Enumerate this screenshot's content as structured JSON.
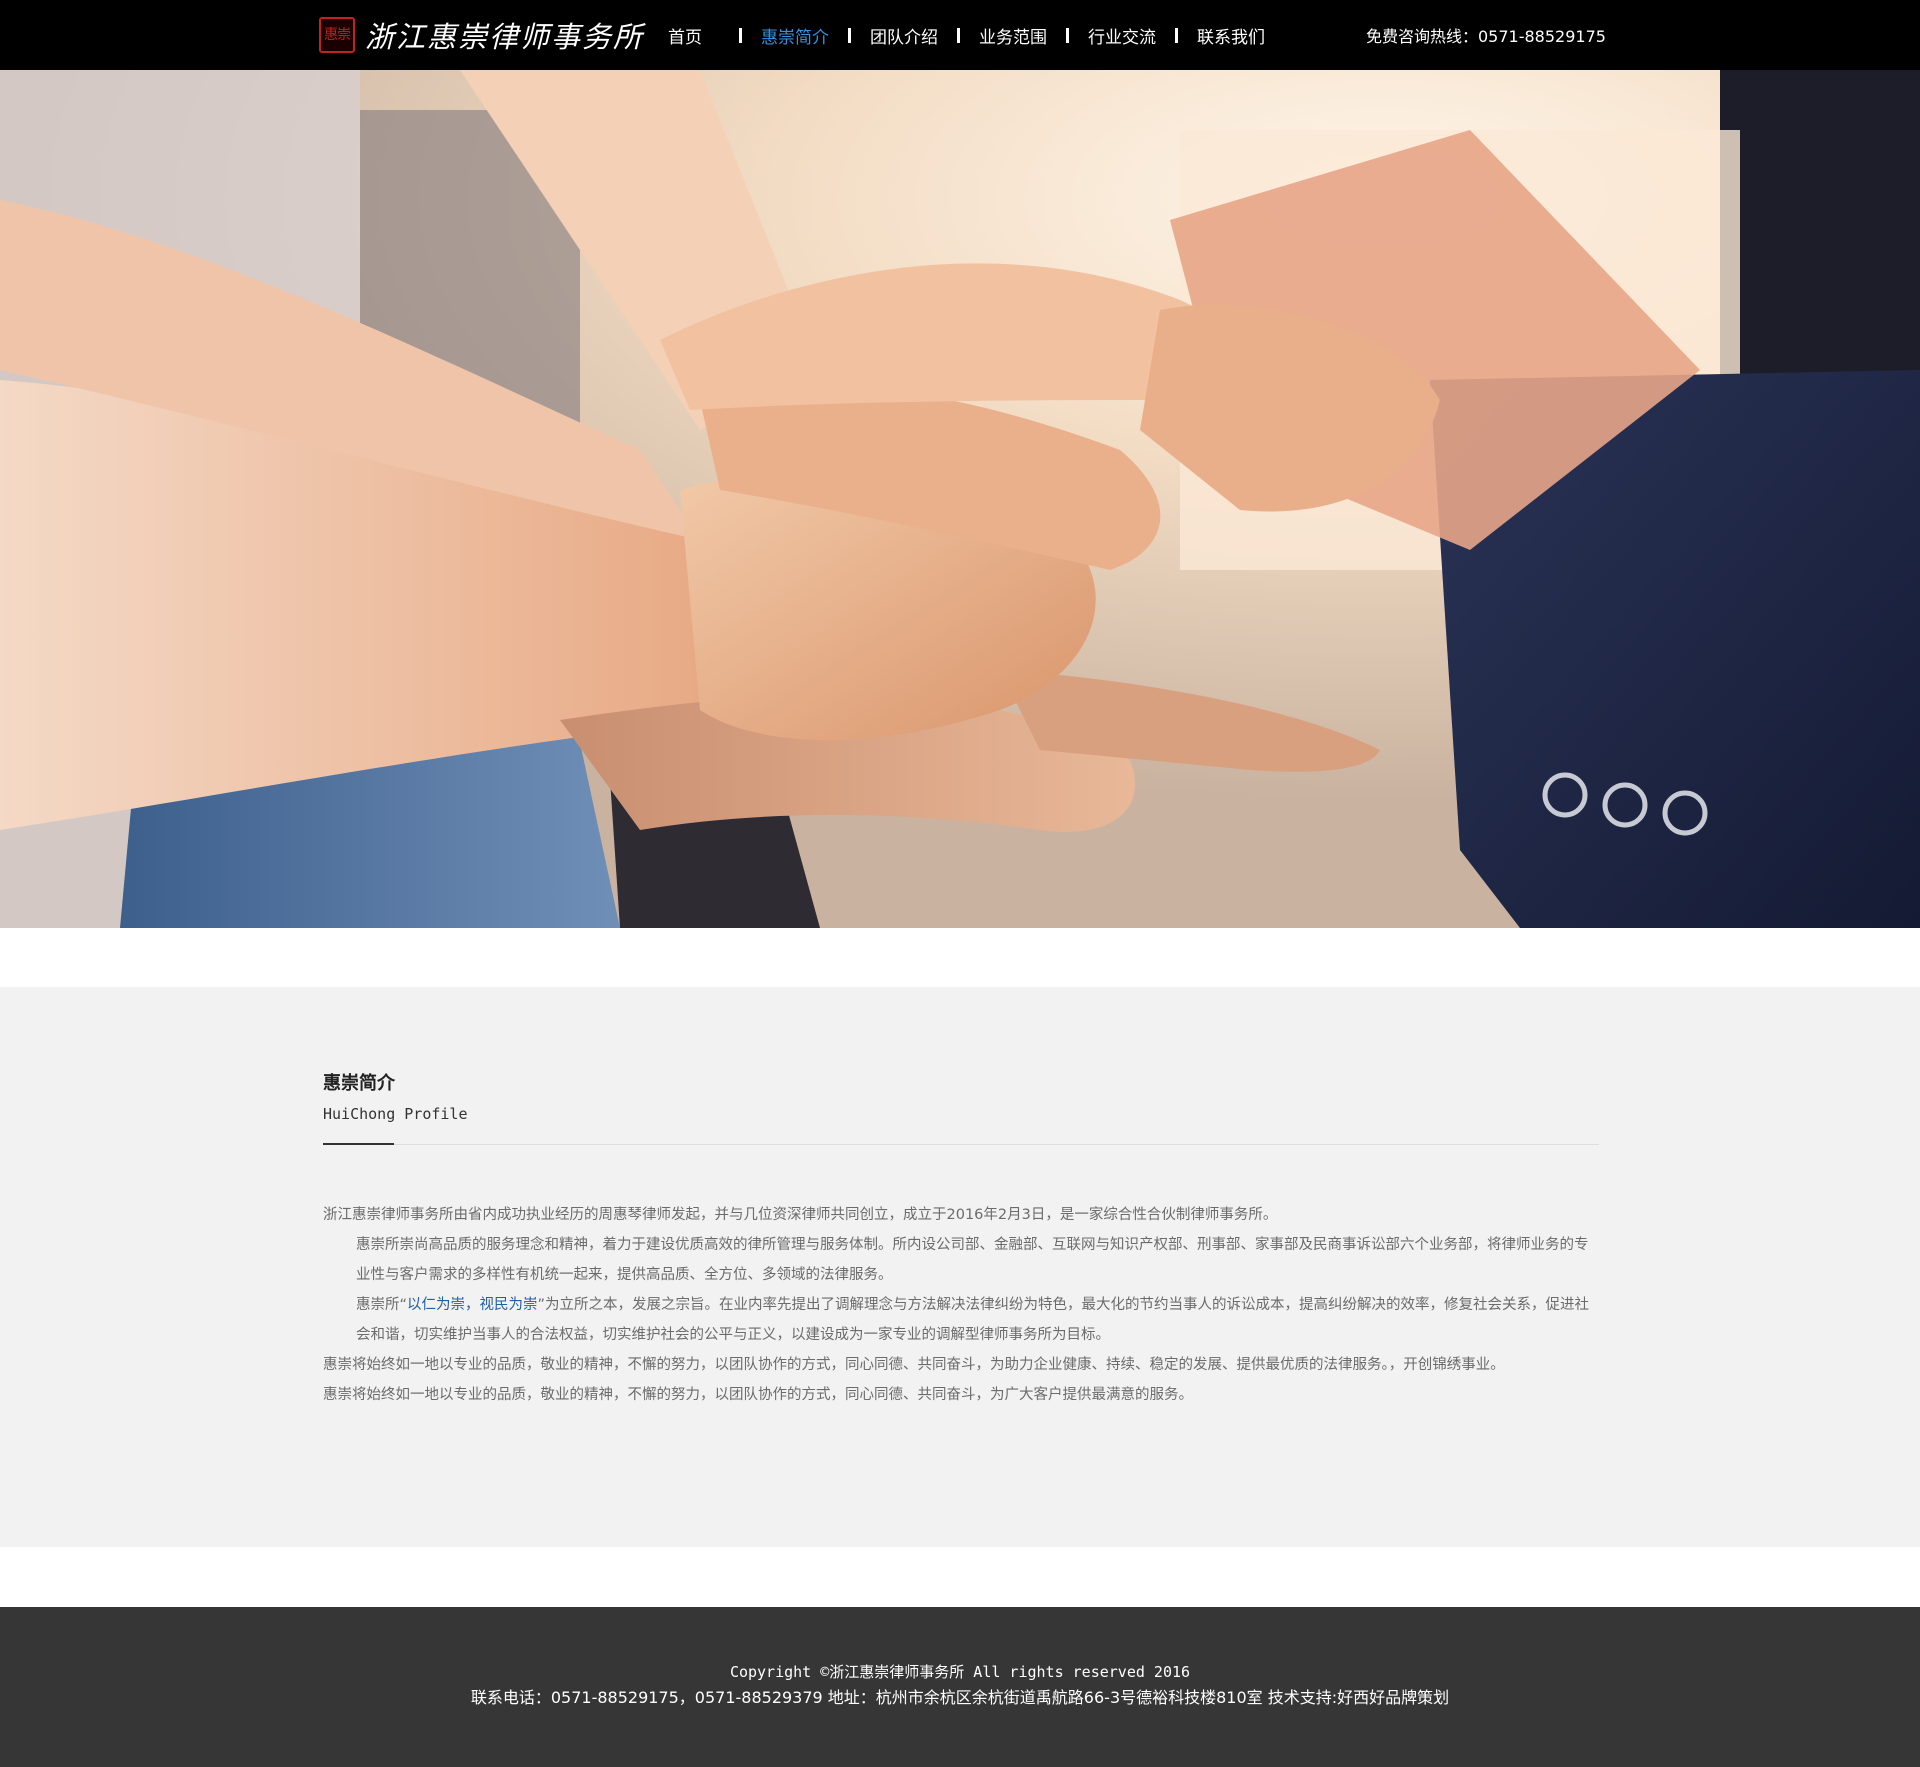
{
  "header": {
    "logo_seal": "惠崇",
    "logo_text": "浙江惠崇律师事务所",
    "nav": [
      {
        "label": "首页",
        "active": false
      },
      {
        "label": "惠崇简介",
        "active": true
      },
      {
        "label": "团队介绍",
        "active": false
      },
      {
        "label": "业务范围",
        "active": false
      },
      {
        "label": "行业交流",
        "active": false
      },
      {
        "label": "联系我们",
        "active": false
      }
    ],
    "hotline": "免费咨询热线：0571-88529175"
  },
  "banner": {
    "image": "stacked-hands-teamwork-photo"
  },
  "profile": {
    "title": "惠崇简介",
    "subtitle": "HuiChong Profile",
    "p1": "浙江惠崇律师事务所由省内成功执业经历的周惠琴律师发起，并与几位资深律师共同创立，成立于2016年2月3日，是一家综合性合伙制律师事务所。",
    "p2": "惠崇所崇尚高品质的服务理念和精神，着力于建设优质高效的律所管理与服务体制。所内设公司部、金融部、互联网与知识产权部、刑事部、家事部及民商事诉讼部六个业务部，将律师业务的专业性与客户需求的多样性有机统一起来，提供高品质、全方位、多领域的法律服务。",
    "p3_prefix": "惠崇所“",
    "p3_highlight": "以仁为崇，视民为崇",
    "p3_suffix": "”为立所之本，发展之宗旨。在业内率先提出了调解理念与方法解决法律纠纷为特色，最大化的节约当事人的诉讼成本，提高纠纷解决的效率，修复社会关系，促进社会和谐，切实维护当事人的合法权益，切实维护社会的公平与正义，以建设成为一家专业的调解型律师事务所为目标。",
    "p4": "惠崇将始终如一地以专业的品质，敬业的精神，不懈的努力，以团队协作的方式，同心同德、共同奋斗，为助力企业健康、持续、稳定的发展、提供最优质的法律服务。，开创锦绣事业。",
    "p5": "惠崇将始终如一地以专业的品质，敬业的精神，不懈的努力，以团队协作的方式，同心同德、共同奋斗，为广大客户提供最满意的服务。"
  },
  "footer": {
    "copyright": "Copyright ©浙江惠崇律师事务所 All rights reserved 2016",
    "contact": "联系电话：0571-88529175，0571-88529379 地址：杭州市余杭区余杭街道禹航路66-3号德裕科技楼810室 技术支持:好西好品牌策划"
  },
  "colors": {
    "header_bg": "#000000",
    "nav_active": "#3a8fd9",
    "highlight": "#1f5fa6",
    "section_bg": "#f2f2f2",
    "footer_bg": "#363636"
  }
}
